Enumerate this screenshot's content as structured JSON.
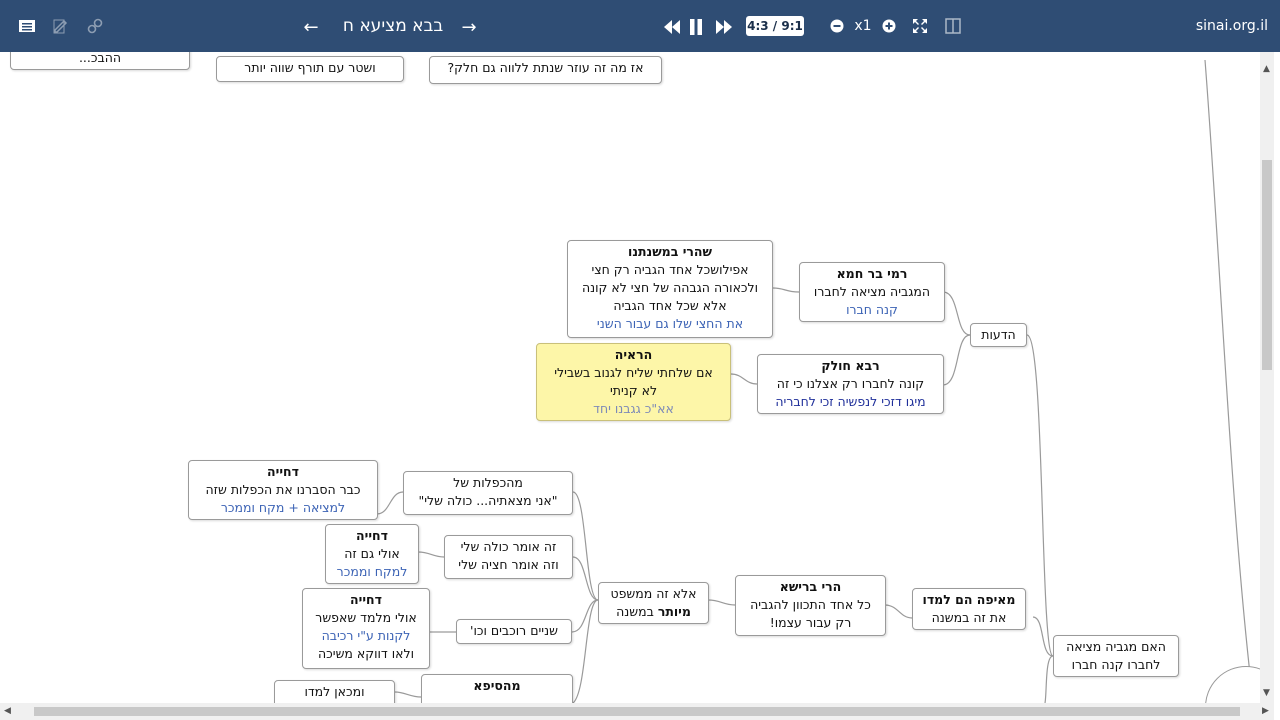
{
  "toolbar": {
    "title": "בבא מציעא ח",
    "page_indicator": "4:3 / 9:1",
    "zoom_level": "x1",
    "site": "sinai.org.il",
    "icons": [
      "list-icon",
      "edit-icon",
      "link-icon",
      "arrow-left-icon",
      "arrow-right-icon",
      "rewind-icon",
      "pause-icon",
      "fast-forward-icon",
      "zoom-out-icon",
      "zoom-in-icon",
      "fullscreen-icon",
      "split-view-icon"
    ]
  },
  "nodes": {
    "top_a": {
      "lines": [
        "ושטר עם תורף שווה יותר"
      ]
    },
    "top_b": {
      "lines": [
        "אז מה זה עוזר שנתת ללווה גם חלק?"
      ]
    },
    "top_c": {
      "lines": [
        "ההבכ..."
      ]
    },
    "sheharei": {
      "heading": "שהרי במשנתנו",
      "lines": [
        "אפילושכל אחד הגביה רק חצי",
        "ולכאורה הגבהה של חצי לא קונה",
        "אלא שכל אחד הגביה"
      ],
      "blue": "את החצי שלו גם עבור השני"
    },
    "rami": {
      "heading": "רמי בר חמא",
      "lines": [
        "המגביה מציאה לחברו"
      ],
      "blue": "קנה חברו"
    },
    "deot": {
      "lines": [
        "הדעות"
      ]
    },
    "raava": {
      "heading": "הראיה",
      "lines": [
        "אם שלחתי שליח לגנוב בשבילי",
        "לא קניתי"
      ],
      "blue": "אא\"כ גגבנו יחד"
    },
    "rava": {
      "heading": "רבא חולק",
      "lines": [
        "קונה לחברו רק אצלנו כי זה"
      ],
      "navy": "מיגו דזכי לנפשיה זכי לחבריה"
    },
    "dchiya1": {
      "heading": "דחייה",
      "lines": [
        "כבר הסברנו את הכפלות שזה"
      ],
      "blue": "למציאה + מקח וממכר"
    },
    "hakpalot": {
      "lines": [
        "מהכפלות של",
        "\"אני מצאתיה... כולה שלי\""
      ]
    },
    "dchiya2": {
      "heading": "דחייה",
      "lines": [
        "אולי גם זה"
      ],
      "blue": "למקח וממכר"
    },
    "zeomer": {
      "lines": [
        "זה אומר כולה שלי",
        "וזה אומר חציה שלי"
      ]
    },
    "dchiya3": {
      "heading": "דחייה",
      "lines": [
        "אולי מלמד שאפשר"
      ],
      "blue": "לקנות  ע\"י רכיבה",
      "extra": "ולאו דווקא משיכה"
    },
    "shnayim": {
      "lines": [
        "שניים רוכבים וכו'"
      ]
    },
    "ela": {
      "lines": [
        "אלא זה ממשפט"
      ],
      "bold_line": "מיותר",
      "tail": " במשנה"
    },
    "harei": {
      "heading": "הרי ברישא",
      "lines": [
        "כל אחד התכוון להגביה",
        "רק  עבור עצמו!"
      ]
    },
    "meifo": {
      "heading": "מאיפה הם למדו",
      "lines": [
        "את זה במשנה"
      ]
    },
    "haim": {
      "lines": [
        "האם מגביה מציאה",
        "לחברו קנה חברו"
      ]
    },
    "umikan": {
      "lines": [
        "ומכאן למדו"
      ]
    },
    "mehasefa": {
      "heading": "מהסיפא",
      "lines": [
        "..."
      ]
    }
  }
}
